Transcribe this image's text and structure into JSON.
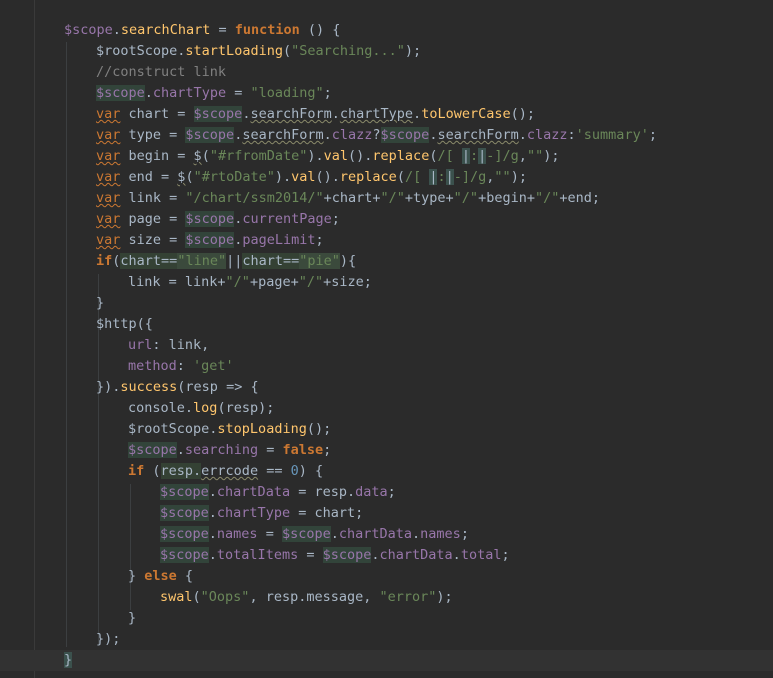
{
  "editor": {
    "lines": [
      {
        "indent": 2,
        "tokens": [
          {
            "t": "$scope",
            "c": "tok-scope"
          },
          {
            "t": ".",
            "c": ""
          },
          {
            "t": "searchChart",
            "c": "tok-fn"
          },
          {
            "t": " = ",
            "c": ""
          },
          {
            "t": "function",
            "c": "tok-kw"
          },
          {
            "t": " () {",
            "c": ""
          }
        ]
      },
      {
        "indent": 3,
        "tokens": [
          {
            "t": "$rootScope",
            "c": ""
          },
          {
            "t": ".",
            "c": ""
          },
          {
            "t": "startLoading",
            "c": "tok-fn"
          },
          {
            "t": "(",
            "c": ""
          },
          {
            "t": "\"Searching...\"",
            "c": "tok-str"
          },
          {
            "t": ");",
            "c": ""
          }
        ]
      },
      {
        "indent": 3,
        "tokens": [
          {
            "t": "//construct link",
            "c": "tok-comment"
          }
        ]
      },
      {
        "indent": 3,
        "tokens": [
          {
            "t": "$scope",
            "c": "tok-scope-hl"
          },
          {
            "t": ".",
            "c": ""
          },
          {
            "t": "chartType",
            "c": "tok-prop"
          },
          {
            "t": " = ",
            "c": ""
          },
          {
            "t": "\"loading\"",
            "c": "tok-str"
          },
          {
            "t": ";",
            "c": ""
          }
        ]
      },
      {
        "indent": 3,
        "tokens": [
          {
            "t": "var",
            "c": "tok-var"
          },
          {
            "t": " chart = ",
            "c": ""
          },
          {
            "t": "$scope",
            "c": "tok-scope-hl"
          },
          {
            "t": ".",
            "c": ""
          },
          {
            "t": "searchForm",
            "c": "tok-typo"
          },
          {
            "t": ".",
            "c": ""
          },
          {
            "t": "chartType",
            "c": "tok-typo"
          },
          {
            "t": ".",
            "c": ""
          },
          {
            "t": "toLowerCase",
            "c": "tok-fn"
          },
          {
            "t": "();",
            "c": ""
          }
        ]
      },
      {
        "indent": 3,
        "tokens": [
          {
            "t": "var",
            "c": "tok-var"
          },
          {
            "t": " type = ",
            "c": ""
          },
          {
            "t": "$scope",
            "c": "tok-scope-hl"
          },
          {
            "t": ".",
            "c": ""
          },
          {
            "t": "searchForm",
            "c": "tok-typo"
          },
          {
            "t": ".",
            "c": ""
          },
          {
            "t": "clazz",
            "c": "tok-prop"
          },
          {
            "t": "?",
            "c": ""
          },
          {
            "t": "$scope",
            "c": "tok-scope-hl"
          },
          {
            "t": ".",
            "c": ""
          },
          {
            "t": "searchForm",
            "c": "tok-typo"
          },
          {
            "t": ".",
            "c": ""
          },
          {
            "t": "clazz",
            "c": "tok-prop"
          },
          {
            "t": ":",
            "c": ""
          },
          {
            "t": "'summary'",
            "c": "tok-str"
          },
          {
            "t": ";",
            "c": ""
          }
        ]
      },
      {
        "indent": 3,
        "tokens": [
          {
            "t": "var",
            "c": "tok-var"
          },
          {
            "t": " begin = ",
            "c": ""
          },
          {
            "t": "$",
            "c": "tok-typo"
          },
          {
            "t": "(",
            "c": ""
          },
          {
            "t": "\"#rfromDate\"",
            "c": "tok-str"
          },
          {
            "t": ").",
            "c": ""
          },
          {
            "t": "val",
            "c": "tok-fn"
          },
          {
            "t": "().",
            "c": ""
          },
          {
            "t": "replace",
            "c": "tok-fn"
          },
          {
            "t": "(",
            "c": ""
          },
          {
            "t": "/[ ",
            "c": "tok-regex"
          },
          {
            "t": "|",
            "c": "tok-regex-hl"
          },
          {
            "t": ":",
            "c": "tok-regex"
          },
          {
            "t": "|",
            "c": "tok-regex-hl"
          },
          {
            "t": "-]/g",
            "c": "tok-regex"
          },
          {
            "t": ",",
            "c": ""
          },
          {
            "t": "\"\"",
            "c": "tok-str"
          },
          {
            "t": ");",
            "c": ""
          }
        ]
      },
      {
        "indent": 3,
        "tokens": [
          {
            "t": "var",
            "c": "tok-var"
          },
          {
            "t": " end = ",
            "c": ""
          },
          {
            "t": "$",
            "c": "tok-typo"
          },
          {
            "t": "(",
            "c": ""
          },
          {
            "t": "\"#rtoDate\"",
            "c": "tok-str"
          },
          {
            "t": ").",
            "c": ""
          },
          {
            "t": "val",
            "c": "tok-fn"
          },
          {
            "t": "().",
            "c": ""
          },
          {
            "t": "replace",
            "c": "tok-fn"
          },
          {
            "t": "(",
            "c": ""
          },
          {
            "t": "/[ ",
            "c": "tok-regex"
          },
          {
            "t": "|",
            "c": "tok-regex-hl"
          },
          {
            "t": ":",
            "c": "tok-regex"
          },
          {
            "t": "|",
            "c": "tok-regex-hl"
          },
          {
            "t": "-]/g",
            "c": "tok-regex"
          },
          {
            "t": ",",
            "c": ""
          },
          {
            "t": "\"\"",
            "c": "tok-str"
          },
          {
            "t": ");",
            "c": ""
          }
        ]
      },
      {
        "indent": 3,
        "tokens": [
          {
            "t": "var",
            "c": "tok-var"
          },
          {
            "t": " link = ",
            "c": ""
          },
          {
            "t": "\"/chart/ssm2014/\"",
            "c": "tok-str"
          },
          {
            "t": "+chart+",
            "c": ""
          },
          {
            "t": "\"/\"",
            "c": "tok-str"
          },
          {
            "t": "+type+",
            "c": ""
          },
          {
            "t": "\"/\"",
            "c": "tok-str"
          },
          {
            "t": "+begin+",
            "c": ""
          },
          {
            "t": "\"/\"",
            "c": "tok-str"
          },
          {
            "t": "+end;",
            "c": ""
          }
        ]
      },
      {
        "indent": 3,
        "tokens": [
          {
            "t": "var",
            "c": "tok-var"
          },
          {
            "t": " page = ",
            "c": ""
          },
          {
            "t": "$scope",
            "c": "tok-scope-hl"
          },
          {
            "t": ".",
            "c": ""
          },
          {
            "t": "currentPage",
            "c": "tok-prop"
          },
          {
            "t": ";",
            "c": ""
          }
        ]
      },
      {
        "indent": 3,
        "tokens": [
          {
            "t": "var",
            "c": "tok-var"
          },
          {
            "t": " size = ",
            "c": ""
          },
          {
            "t": "$scope",
            "c": "tok-scope-hl"
          },
          {
            "t": ".",
            "c": ""
          },
          {
            "t": "pageLimit",
            "c": "tok-prop"
          },
          {
            "t": ";",
            "c": ""
          }
        ]
      },
      {
        "indent": 3,
        "tokens": [
          {
            "t": "if",
            "c": "tok-kw"
          },
          {
            "t": "(",
            "c": ""
          },
          {
            "t": "chart==",
            "c": "tok-hlbox"
          },
          {
            "t": "\"line\"",
            "c": "tok-str-hl"
          },
          {
            "t": "||",
            "c": ""
          },
          {
            "t": "chart==",
            "c": "tok-hlbox"
          },
          {
            "t": "\"pie\"",
            "c": "tok-str-hl"
          },
          {
            "t": "){",
            "c": ""
          }
        ]
      },
      {
        "indent": 4,
        "tokens": [
          {
            "t": "link = link+",
            "c": ""
          },
          {
            "t": "\"/\"",
            "c": "tok-str"
          },
          {
            "t": "+page+",
            "c": ""
          },
          {
            "t": "\"/\"",
            "c": "tok-str"
          },
          {
            "t": "+size;",
            "c": ""
          }
        ]
      },
      {
        "indent": 3,
        "tokens": [
          {
            "t": "}",
            "c": ""
          }
        ]
      },
      {
        "indent": 3,
        "tokens": [
          {
            "t": "$http",
            "c": ""
          },
          {
            "t": "({",
            "c": ""
          }
        ]
      },
      {
        "indent": 4,
        "tokens": [
          {
            "t": "url",
            "c": "tok-prop"
          },
          {
            "t": ": link,",
            "c": ""
          }
        ]
      },
      {
        "indent": 4,
        "tokens": [
          {
            "t": "method",
            "c": "tok-prop"
          },
          {
            "t": ": ",
            "c": ""
          },
          {
            "t": "'get'",
            "c": "tok-str"
          }
        ]
      },
      {
        "indent": 3,
        "tokens": [
          {
            "t": "}).",
            "c": ""
          },
          {
            "t": "success",
            "c": "tok-fn"
          },
          {
            "t": "(resp => {",
            "c": ""
          }
        ]
      },
      {
        "indent": 4,
        "tokens": [
          {
            "t": "console",
            "c": ""
          },
          {
            "t": ".",
            "c": ""
          },
          {
            "t": "log",
            "c": "tok-fn"
          },
          {
            "t": "(resp);",
            "c": ""
          }
        ]
      },
      {
        "indent": 4,
        "tokens": [
          {
            "t": "$rootScope",
            "c": ""
          },
          {
            "t": ".",
            "c": ""
          },
          {
            "t": "stopLoading",
            "c": "tok-fn"
          },
          {
            "t": "();",
            "c": ""
          }
        ]
      },
      {
        "indent": 4,
        "tokens": [
          {
            "t": "$scope",
            "c": "tok-scope-hl"
          },
          {
            "t": ".",
            "c": ""
          },
          {
            "t": "searching",
            "c": "tok-prop"
          },
          {
            "t": " = ",
            "c": ""
          },
          {
            "t": "false",
            "c": "tok-kw"
          },
          {
            "t": ";",
            "c": ""
          }
        ]
      },
      {
        "indent": 4,
        "tokens": [
          {
            "t": "if",
            "c": "tok-kw"
          },
          {
            "t": " (",
            "c": ""
          },
          {
            "t": "resp.",
            "c": "tok-hlbox"
          },
          {
            "t": "errcode",
            "c": "tok-typo"
          },
          {
            "t": " == ",
            "c": ""
          },
          {
            "t": "0",
            "c": "tok-num"
          },
          {
            "t": ") {",
            "c": ""
          }
        ]
      },
      {
        "indent": 5,
        "tokens": [
          {
            "t": "$scope",
            "c": "tok-scope-hl"
          },
          {
            "t": ".",
            "c": ""
          },
          {
            "t": "chartData",
            "c": "tok-prop"
          },
          {
            "t": " = resp.",
            "c": ""
          },
          {
            "t": "data",
            "c": "tok-prop"
          },
          {
            "t": ";",
            "c": ""
          }
        ]
      },
      {
        "indent": 5,
        "tokens": [
          {
            "t": "$scope",
            "c": "tok-scope-hl"
          },
          {
            "t": ".",
            "c": ""
          },
          {
            "t": "chartType",
            "c": "tok-prop"
          },
          {
            "t": " = chart;",
            "c": ""
          }
        ]
      },
      {
        "indent": 5,
        "tokens": [
          {
            "t": "$scope",
            "c": "tok-scope-hl"
          },
          {
            "t": ".",
            "c": ""
          },
          {
            "t": "names",
            "c": "tok-prop"
          },
          {
            "t": " = ",
            "c": ""
          },
          {
            "t": "$scope",
            "c": "tok-scope-hl"
          },
          {
            "t": ".",
            "c": ""
          },
          {
            "t": "chartData",
            "c": "tok-prop"
          },
          {
            "t": ".",
            "c": ""
          },
          {
            "t": "names",
            "c": "tok-prop"
          },
          {
            "t": ";",
            "c": ""
          }
        ]
      },
      {
        "indent": 5,
        "tokens": [
          {
            "t": "$scope",
            "c": "tok-scope-hl"
          },
          {
            "t": ".",
            "c": ""
          },
          {
            "t": "totalItems",
            "c": "tok-prop"
          },
          {
            "t": " = ",
            "c": ""
          },
          {
            "t": "$scope",
            "c": "tok-scope-hl"
          },
          {
            "t": ".",
            "c": ""
          },
          {
            "t": "chartData",
            "c": "tok-prop"
          },
          {
            "t": ".",
            "c": ""
          },
          {
            "t": "total",
            "c": "tok-prop"
          },
          {
            "t": ";",
            "c": ""
          }
        ]
      },
      {
        "indent": 4,
        "tokens": [
          {
            "t": "} ",
            "c": ""
          },
          {
            "t": "else",
            "c": "tok-kw"
          },
          {
            "t": " {",
            "c": ""
          }
        ]
      },
      {
        "indent": 5,
        "tokens": [
          {
            "t": "swal",
            "c": "tok-fn"
          },
          {
            "t": "(",
            "c": ""
          },
          {
            "t": "\"Oops\"",
            "c": "tok-str"
          },
          {
            "t": ", resp.message, ",
            "c": ""
          },
          {
            "t": "\"error\"",
            "c": "tok-str"
          },
          {
            "t": ");",
            "c": ""
          }
        ]
      },
      {
        "indent": 4,
        "tokens": [
          {
            "t": "}",
            "c": ""
          }
        ]
      },
      {
        "indent": 3,
        "tokens": [
          {
            "t": "});",
            "c": ""
          }
        ]
      },
      {
        "indent": 2,
        "tokens": [
          {
            "t": "}",
            "c": "caret-brace"
          }
        ]
      }
    ]
  }
}
